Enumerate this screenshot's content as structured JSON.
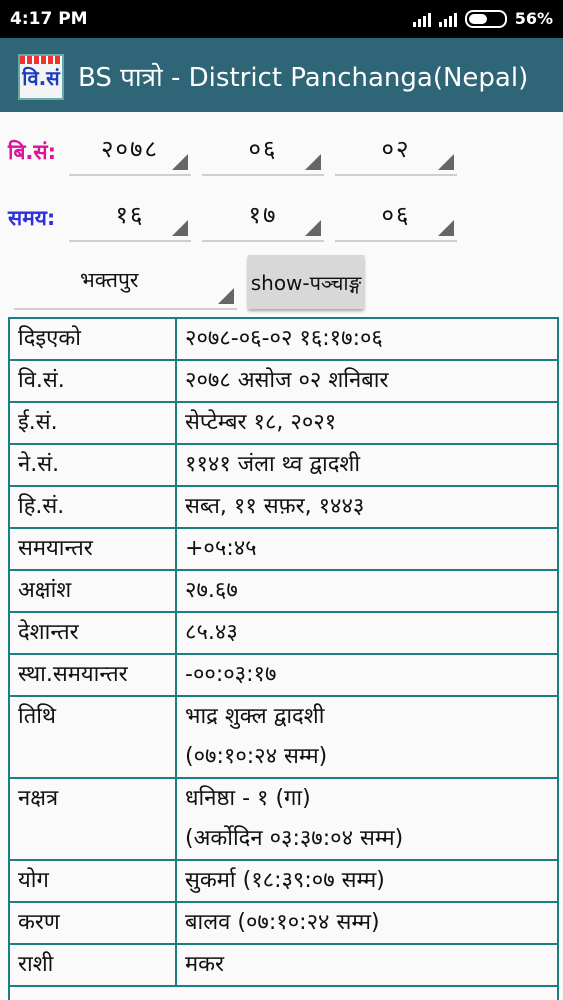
{
  "status": {
    "time": "4:17 PM",
    "battery": "56%"
  },
  "app": {
    "icon_text": "वि.सं",
    "title": "BS पात्रो - District Panchanga(Nepal)"
  },
  "form": {
    "date_label": "बि.सं:",
    "date_year": "२०७८",
    "date_month": "०६",
    "date_day": "०२",
    "time_label": "समय:",
    "time_hour": "१६",
    "time_minute": "१७",
    "time_second": "०६",
    "district": "भक्तपुर",
    "show_button": "show-पञ्चाङ्ग"
  },
  "colors": {
    "date_label": "#e0119a",
    "time_label": "#3030e0",
    "table_border": "#1b7f82",
    "appbar": "#2e6577"
  },
  "table": {
    "rows": [
      {
        "key": "दिइएको",
        "value": "२०७८-०६-०२ १६:१७:०६"
      },
      {
        "key": "वि.सं.",
        "value": "२०७८ असोज ०२ शनिबार"
      },
      {
        "key": "ई.सं.",
        "value": "सेप्टेम्बर १८, २०२१"
      },
      {
        "key": "ने.सं.",
        "value": "११४१ जंला थ्व द्वादशी"
      },
      {
        "key": "हि.सं.",
        "value": "सब्त, ११ सफ़र, १४४३"
      },
      {
        "key": "समयान्तर",
        "value": "+०५:४५"
      },
      {
        "key": "अक्षांश",
        "value": "२७.६७"
      },
      {
        "key": "देशान्तर",
        "value": "८५.४३"
      },
      {
        "key": "स्था.समयान्तर",
        "value": "-००:०३:१७"
      },
      {
        "key": "तिथि",
        "value": "भाद्र शुक्ल द्वादशी",
        "value2": "(०७:१०:२४ सम्म)"
      },
      {
        "key": "नक्षत्र",
        "value": "धनिष्ठा - १ (गा)",
        "value2": "(अर्कोदिन ०३:३७:०४ सम्म)"
      },
      {
        "key": "योग",
        "value": "सुकर्मा (१८:३९:०७ सम्म)"
      },
      {
        "key": "करण",
        "value": "बालव (०७:१०:२४ सम्म)"
      },
      {
        "key": "राशी",
        "value": "मकर"
      }
    ]
  }
}
